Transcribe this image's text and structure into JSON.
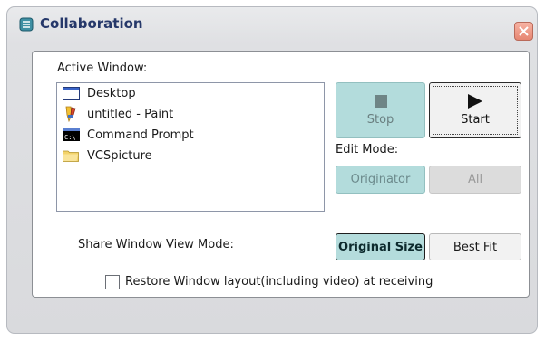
{
  "window": {
    "title": "Collaboration",
    "icons": {
      "title": "collaboration-icon",
      "close": "close-icon"
    }
  },
  "active_window": {
    "label": "Active Window:",
    "items": [
      {
        "label": "Desktop",
        "icon": "desktop-icon"
      },
      {
        "label": "untitled - Paint",
        "icon": "paint-icon"
      },
      {
        "label": "Command Prompt",
        "icon": "command-prompt-icon"
      },
      {
        "label": "VCSpicture",
        "icon": "folder-icon"
      }
    ]
  },
  "controls": {
    "stop_label": "Stop",
    "start_label": "Start"
  },
  "edit_mode": {
    "label": "Edit Mode:",
    "originator_label": "Originator",
    "all_label": "All"
  },
  "share_view": {
    "label": "Share Window View Mode:",
    "original_size_label": "Original Size",
    "best_fit_label": "Best Fit",
    "selected": "Original Size"
  },
  "restore": {
    "label": "Restore Window layout(including video) at receiving",
    "checked": false
  },
  "colors": {
    "title_text": "#26386a",
    "accent_button": "#b3dcdc",
    "close_button": "#e68672"
  }
}
